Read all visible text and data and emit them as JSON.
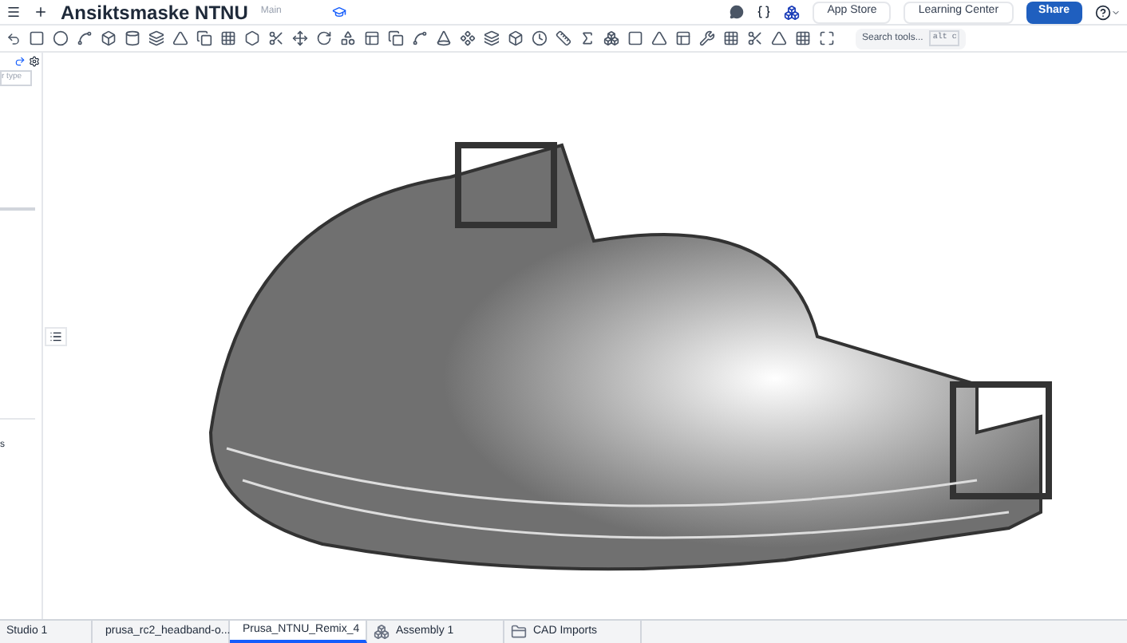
{
  "document": {
    "title": "Ansiktsmaske NTNU",
    "branch": "Main"
  },
  "header_buttons": [
    "App Store",
    "Learning Center",
    "Share"
  ],
  "search_tools": {
    "placeholder": "Search tools...",
    "shortcut": "alt c"
  },
  "feature_panel": {
    "filter_placeholder": "r type",
    "footer_text": "s"
  },
  "tabs": [
    {
      "label": "Studio 1",
      "kind": "studio",
      "selected": false
    },
    {
      "label": "prusa_rc2_headband-o...",
      "kind": "partstudio",
      "selected": false
    },
    {
      "label": "Prusa_NTNU_Remix_4",
      "kind": "partstudio",
      "selected": true
    },
    {
      "label": "Assembly 1",
      "kind": "assembly",
      "selected": false
    },
    {
      "label": "CAD Imports",
      "kind": "folder",
      "selected": false
    }
  ]
}
